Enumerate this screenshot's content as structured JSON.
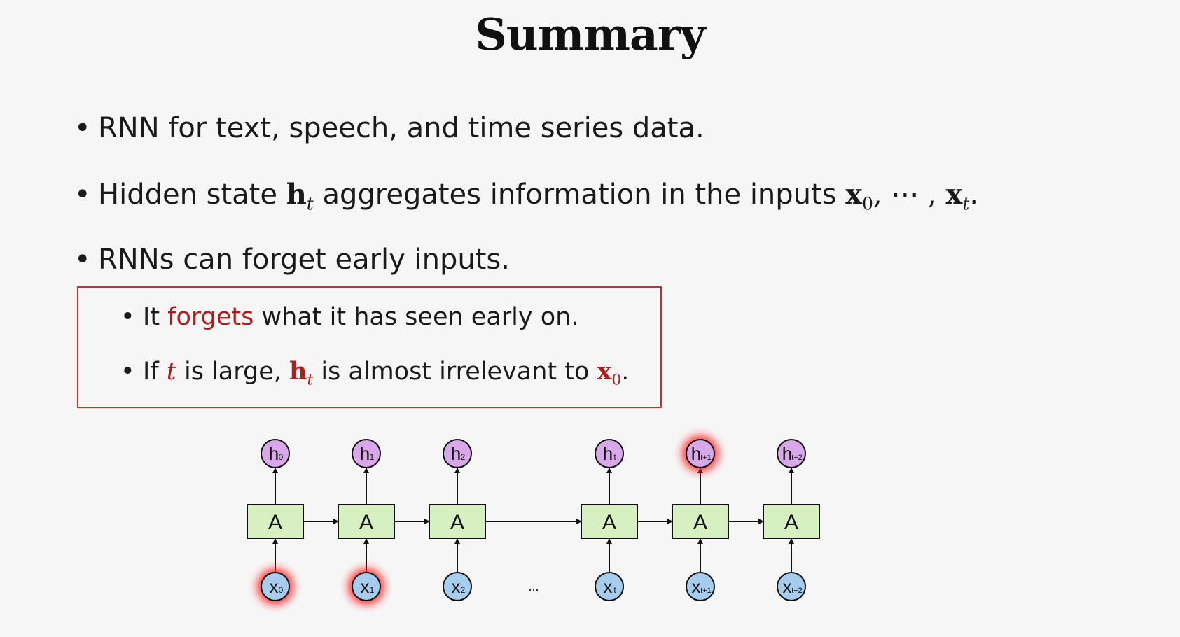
{
  "title": "Summary",
  "bullets": {
    "b1": "RNN for text, speech, and time series data.",
    "b2": {
      "pre": "Hidden state ",
      "h": "h",
      "h_sub": "t",
      "mid": " aggregates information in the inputs ",
      "x0": "x",
      "x0_sub": "0",
      "dots": ", ⋯ , ",
      "xt": "x",
      "xt_sub": "t",
      "end": "."
    },
    "b3": "RNNs can forget early inputs."
  },
  "box": {
    "s1": {
      "pre": "It ",
      "highlight": "forgets",
      "post": " what it has seen early on."
    },
    "s2": {
      "pre": "If ",
      "t": "t",
      "mid1": " is large, ",
      "h": "h",
      "h_sub": "t",
      "mid2": " is almost irrelevant to ",
      "x": "x",
      "x_sub": "0",
      "end": "."
    }
  },
  "diagram": {
    "cells": [
      {
        "block": "A",
        "h": "h",
        "h_sub": "0",
        "x": "x",
        "x_sub": "0",
        "h_glow": false,
        "x_glow": true
      },
      {
        "block": "A",
        "h": "h",
        "h_sub": "1",
        "x": "x",
        "x_sub": "1",
        "h_glow": false,
        "x_glow": true
      },
      {
        "block": "A",
        "h": "h",
        "h_sub": "2",
        "x": "x",
        "x_sub": "2",
        "h_glow": false,
        "x_glow": false
      },
      {
        "block": "A",
        "h": "h",
        "h_sub": "t",
        "x": "x",
        "x_sub": "t",
        "h_glow": false,
        "x_glow": false
      },
      {
        "block": "A",
        "h": "h",
        "h_sub": "t+1",
        "x": "x",
        "x_sub": "t+1",
        "h_glow": true,
        "x_glow": false
      },
      {
        "block": "A",
        "h": "h",
        "h_sub": "t+2",
        "x": "x",
        "x_sub": "t+2",
        "h_glow": false,
        "x_glow": false
      }
    ],
    "ellipsis": "...",
    "colors": {
      "block_fill": "#d6f0c2",
      "h_fill": "#d9a8ea",
      "x_fill": "#a7cdee",
      "glow": "#ff2020"
    }
  }
}
